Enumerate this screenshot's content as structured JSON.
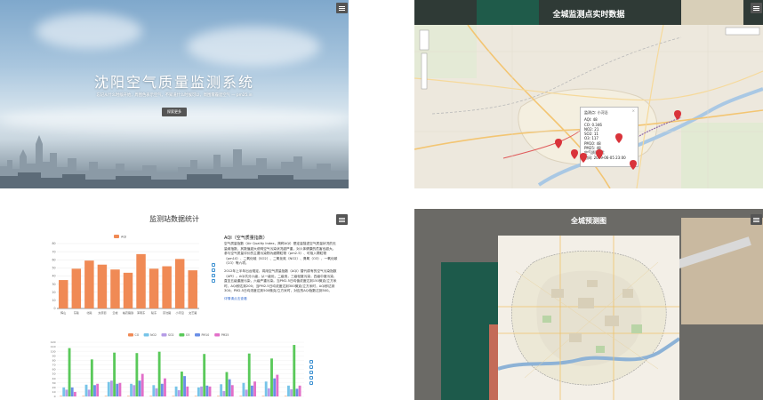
{
  "hero": {
    "title": "沈阳空气质量监测系统",
    "subtitle": "忘记从什么时候开始，周围色表示空气，不知道什么时候可以，周围雾霾遮空气 — pm25.in",
    "button_label": "探索更多"
  },
  "realtime": {
    "title": "全城监测点实时数据",
    "info_window": {
      "station": "监测点: 小河沿",
      "lines": [
        "AQI: 48",
        "CO: 0.346",
        "NO2: 21",
        "SO2: 11",
        "O3: 117",
        "PM10: 48",
        "PM25: 48",
        "空气质量: 优",
        "时间: 2019-06-05 23:00"
      ]
    }
  },
  "stats": {
    "title": "监测站数据统计",
    "aqi_title": "AQI（空气质量指数）",
    "aqi_paragraph_1": "空气质量指数（Air Quality Index，简称AQI）是定量描述空气质量状况的无量纲指数，其数值越大说明空气污染状况越严重，对人体健康的危害也越大。参与空气质量评价的主要污染物为细颗粒物（pm2.5）、可吸入颗粒物（pm10）、二氧化硫（SO2）、二氧化氮（NO2）、臭氧（O3）、一氧化碳（CO）等六项。",
    "aqi_paragraph_2": "2012年上半年出台规定，将用空气质量指数（AQI）替代原有的空气污染指数（API）。AQI共分六级，从一级优，二级良，三级轻度污染，四级中度污染，直至五级重度污染，六级严重污染。当PM2.5日均值浓度达到150微克/立方米时，AQI即达到200；当PM2.5日均浓度达到300微克/立方米时，AQI即达到300；PM2.5日均浓度达到500微克/立方米时，对应的AQI指数达到500。",
    "more_link": "详情请点击查看"
  },
  "prediction": {
    "title": "全城预测图"
  },
  "chart_data": [
    {
      "type": "bar",
      "series": [
        {
          "name": "AQI",
          "values": [
            35,
            49,
            59,
            54,
            48,
            44,
            67,
            49,
            52,
            61,
            47
          ]
        }
      ],
      "categories": [
        "辉山",
        "东陵",
        "北陵",
        "太原街",
        "云峰",
        "裕农路铁",
        "浑南东",
        "陵东",
        "京沈路",
        "小河沿",
        "文艺路"
      ],
      "ylim": [
        0,
        80
      ],
      "yticks": [
        0,
        10,
        20,
        30,
        40,
        50,
        60,
        70,
        80
      ],
      "legend": "top-center",
      "color": "#f08a55"
    },
    {
      "type": "bar",
      "legend_items": [
        {
          "name": "CO",
          "color": "#f08a55"
        },
        {
          "name": "NO2",
          "color": "#77c4e8"
        },
        {
          "name": "SO2",
          "color": "#b69ce6"
        },
        {
          "name": "O3",
          "color": "#5ac95a"
        },
        {
          "name": "PM10",
          "color": "#6a8fe6"
        },
        {
          "name": "PM25",
          "color": "#e26fc9"
        }
      ],
      "series": [
        {
          "name": "CO",
          "values": [
            1,
            1,
            1,
            1,
            1,
            1,
            1,
            1,
            1,
            1,
            1
          ]
        },
        {
          "name": "NO2",
          "values": [
            20,
            26,
            32,
            28,
            25,
            22,
            20,
            27,
            30,
            33,
            24
          ]
        },
        {
          "name": "SO2",
          "values": [
            15,
            15,
            35,
            25,
            18,
            14,
            22,
            12,
            15,
            18,
            16
          ]
        },
        {
          "name": "O3",
          "values": [
            107,
            82,
            97,
            96,
            99,
            55,
            94,
            54,
            95,
            84,
            114
          ]
        },
        {
          "name": "PM10",
          "values": [
            20,
            25,
            28,
            35,
            28,
            45,
            24,
            38,
            24,
            40,
            17
          ]
        },
        {
          "name": "PM25",
          "values": [
            10,
            28,
            30,
            50,
            40,
            22,
            22,
            25,
            33,
            48,
            24
          ]
        }
      ],
      "categories": [
        "辉山",
        "东陵",
        "北陵",
        "太原街",
        "云峰",
        "裕农路铁",
        "浑南东",
        "陵东",
        "京沈路",
        "小河沿",
        "文艺路"
      ],
      "ylim": [
        0,
        120
      ],
      "yticks": [
        0,
        10,
        20,
        30,
        40,
        50,
        60,
        70,
        80,
        90,
        100,
        110,
        120
      ],
      "legend": "top-center"
    }
  ]
}
